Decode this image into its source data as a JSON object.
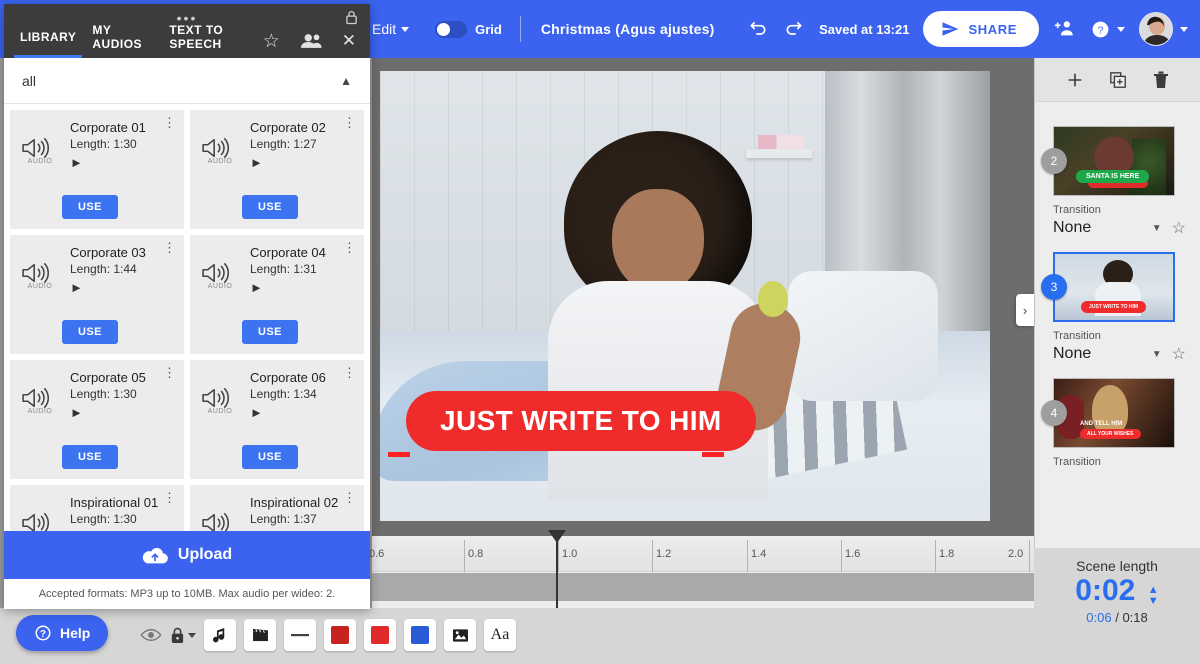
{
  "topbar": {
    "edit_label": "Edit",
    "grid_label": "Grid",
    "grid_enabled": false,
    "project_title": "Christmas (Agus ajustes)",
    "undo_icon": "undo-icon",
    "redo_icon": "redo-icon",
    "saved_status": "Saved at 13:21",
    "share_label": "SHARE",
    "invite_icon": "add-person-icon",
    "help_icon": "question-circle-icon",
    "accent_color": "#3b63f0"
  },
  "canvas": {
    "banner_text": "JUST WRITE TO HIM",
    "banner_color": "#ef2b2b",
    "side_toggle_icon": "chevron-right-icon"
  },
  "timeline": {
    "ticks": [
      "0.6",
      "0.8",
      "1.0",
      "1.2",
      "1.4",
      "1.6",
      "1.8",
      "2.0"
    ],
    "playhead_position": "1.0"
  },
  "bottom_toolbar": {
    "items": [
      {
        "name": "visibility-eye-icon",
        "glyph": "◉",
        "type": "icon"
      },
      {
        "name": "lock-icon",
        "glyph": "🔒",
        "type": "lock"
      },
      {
        "name": "music-note-icon",
        "glyph": "♪",
        "type": "tool"
      },
      {
        "name": "video-clapper-icon",
        "glyph": "🎬",
        "type": "tool"
      },
      {
        "name": "line-shape-icon",
        "glyph": "—",
        "type": "tool"
      },
      {
        "name": "color-swatch-dark-red",
        "color": "#c62222",
        "type": "swatch"
      },
      {
        "name": "color-swatch-red",
        "color": "#e02b2b",
        "type": "swatch"
      },
      {
        "name": "color-swatch-blue",
        "color": "#2a5bd7",
        "type": "swatch"
      },
      {
        "name": "image-icon",
        "glyph": "⛰",
        "type": "tool"
      },
      {
        "name": "text-icon",
        "glyph": "Aa",
        "type": "tool"
      }
    ]
  },
  "help": {
    "label": "Help",
    "icon": "question-circle-icon"
  },
  "scene_panel": {
    "tools": [
      {
        "name": "add-scene-button",
        "glyph": "+"
      },
      {
        "name": "duplicate-scene-button",
        "glyph": "⧉"
      },
      {
        "name": "delete-scene-button",
        "glyph": "🗑"
      }
    ],
    "transition_label": "Transition",
    "scenes": [
      {
        "number": "2",
        "transition": "None",
        "selected": false,
        "caption": "SANTA IS HERE"
      },
      {
        "number": "3",
        "transition": "None",
        "selected": true,
        "caption": "JUST WRITE TO HIM"
      },
      {
        "number": "4",
        "transition": "Transition",
        "selected": false,
        "caption_top": "AND TELL HIM",
        "caption": "ALL YOUR WISHES"
      }
    ],
    "scene_length": {
      "label": "Scene length",
      "value": "0:02",
      "elapsed": "0:06",
      "separator": "/",
      "total": "0:18"
    }
  },
  "audio_panel": {
    "lock_icon": "lock-icon",
    "drag_icon": "drag-dots-icon",
    "tabs": [
      {
        "label": "LIBRARY",
        "active": true
      },
      {
        "label": "MY AUDIOS",
        "active": false
      },
      {
        "label": "TEXT TO SPEECH",
        "active": false
      }
    ],
    "tab_icons": [
      {
        "name": "star-icon",
        "glyph": "☆"
      },
      {
        "name": "people-icon",
        "glyph": "👥"
      },
      {
        "name": "close-icon",
        "glyph": "✕"
      }
    ],
    "filter": {
      "value": "all",
      "caret_icon": "chevron-up-icon"
    },
    "card_labels": {
      "audio_tag": "AUDIO",
      "use": "USE",
      "kebab_icon": "more-vertical-icon",
      "play_icon": "play-icon"
    },
    "tracks": [
      {
        "title": "Corporate 01",
        "length": "Length: 1:30"
      },
      {
        "title": "Corporate 02",
        "length": "Length: 1:27"
      },
      {
        "title": "Corporate 03",
        "length": "Length: 1:44"
      },
      {
        "title": "Corporate 04",
        "length": "Length: 1:31"
      },
      {
        "title": "Corporate 05",
        "length": "Length: 1:30"
      },
      {
        "title": "Corporate 06",
        "length": "Length: 1:34"
      },
      {
        "title": "Inspirational 01",
        "length": "Length: 1:30"
      },
      {
        "title": "Inspirational 02",
        "length": "Length: 1:37"
      }
    ],
    "upload": {
      "label": "Upload",
      "icon": "cloud-upload-icon"
    },
    "note": "Accepted formats: MP3 up to 10MB. Max audio per wideo: 2."
  }
}
